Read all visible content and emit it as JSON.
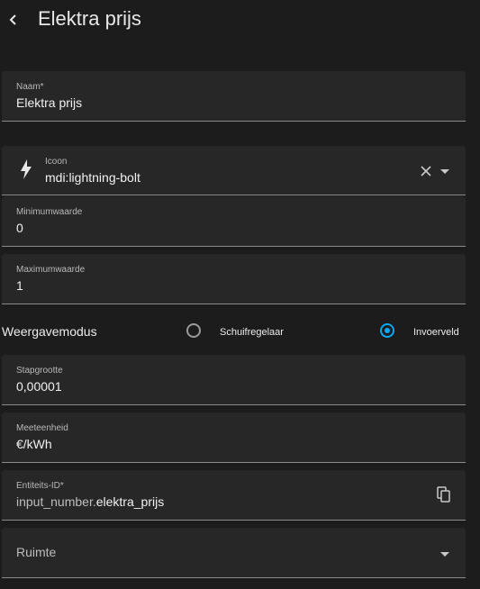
{
  "header": {
    "title": "Elektra prijs"
  },
  "name_field": {
    "label": "Naam*",
    "value": "Elektra prijs"
  },
  "icon_field": {
    "label": "Icoon",
    "value": "mdi:lightning-bolt"
  },
  "min_field": {
    "label": "Minimumwaarde",
    "value": "0"
  },
  "max_field": {
    "label": "Maximumwaarde",
    "value": "1"
  },
  "display_mode": {
    "label": "Weergavemodus",
    "options": [
      {
        "label": "Schuifregelaar",
        "selected": false
      },
      {
        "label": "Invoerveld",
        "selected": true
      }
    ]
  },
  "step_field": {
    "label": "Stapgrootte",
    "value": "0,00001"
  },
  "unit_field": {
    "label": "Meeteenheid",
    "value": "€/kWh"
  },
  "entity_field": {
    "label": "Entiteits-ID*",
    "prefix": "input_number.",
    "value": "elektra_prijs"
  },
  "area_field": {
    "placeholder": "Ruimte"
  },
  "colors": {
    "accent": "#03a9f4",
    "background": "#1c1c1c",
    "field": "#272727"
  }
}
